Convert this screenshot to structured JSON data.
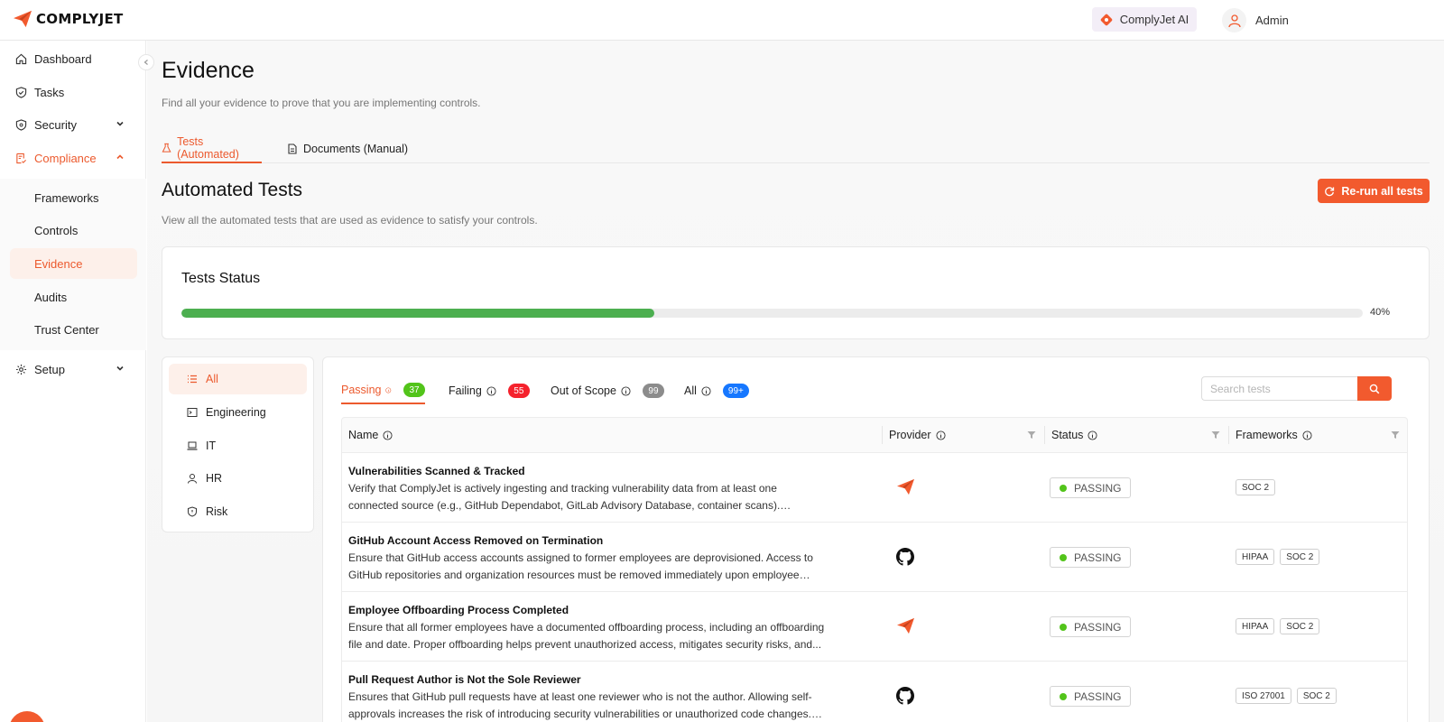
{
  "brand": {
    "name": "COMPLYJET",
    "accent": "#f25a2e"
  },
  "topbar": {
    "ai_label": "ComplyJet AI",
    "user_name": "Admin"
  },
  "sidebar": {
    "items": [
      {
        "label": "Dashboard",
        "icon": "home-icon"
      },
      {
        "label": "Tasks",
        "icon": "shield-check-icon"
      },
      {
        "label": "Security",
        "icon": "shield-icon"
      },
      {
        "label": "Compliance",
        "icon": "compliance-doc-icon"
      },
      {
        "label": "Setup",
        "icon": "gear-icon"
      }
    ],
    "compliance_sub": [
      {
        "label": "Frameworks"
      },
      {
        "label": "Controls"
      },
      {
        "label": "Evidence",
        "active": true
      },
      {
        "label": "Audits"
      },
      {
        "label": "Trust Center"
      }
    ]
  },
  "page": {
    "title": "Evidence",
    "description": "Find all your evidence to prove that you are implementing controls.",
    "tabs": [
      {
        "label": "Tests (Automated)",
        "active": true
      },
      {
        "label": "Documents (Manual)"
      }
    ]
  },
  "section": {
    "title": "Automated Tests",
    "description": "View all the automated tests that are used as evidence to satisfy your controls.",
    "rerun_label": "Re-run all tests"
  },
  "status": {
    "title": "Tests Status",
    "percent": 40,
    "percent_label": "40%"
  },
  "categories": [
    {
      "label": "All",
      "icon": "list-icon",
      "active": true
    },
    {
      "label": "Engineering",
      "icon": "terminal-icon"
    },
    {
      "label": "IT",
      "icon": "laptop-icon"
    },
    {
      "label": "HR",
      "icon": "user-icon"
    },
    {
      "label": "Risk",
      "icon": "shield-icon"
    }
  ],
  "filters": [
    {
      "label": "Passing",
      "count": "37",
      "color": "#52c41a",
      "active": true
    },
    {
      "label": "Failing",
      "count": "55",
      "color": "#f5222d"
    },
    {
      "label": "Out of Scope",
      "count": "99",
      "color": "#8c8c8c"
    },
    {
      "label": "All",
      "count": "99+",
      "color": "#1677ff"
    }
  ],
  "search": {
    "placeholder": "Search tests"
  },
  "table": {
    "columns": [
      "Name",
      "Provider",
      "Status",
      "Frameworks"
    ],
    "rows": [
      {
        "title": "Vulnerabilities Scanned & Tracked",
        "description": "Verify that ComplyJet is actively ingesting and tracking vulnerability data from at least one connected source (e.g., GitHub Dependabot, GitLab Advisory Database, container scans). Continuous vulnerability tracking...",
        "provider": "complyjet-icon",
        "status": "PASSING",
        "frameworks": [
          "SOC 2"
        ]
      },
      {
        "title": "GitHub Account Access Removed on Termination",
        "description": "Ensure that GitHub access accounts assigned to former employees are deprovisioned. Access to GitHub repositories and organization resources must be removed immediately upon employee termination...",
        "provider": "github-icon",
        "status": "PASSING",
        "frameworks": [
          "HIPAA",
          "SOC 2"
        ]
      },
      {
        "title": "Employee Offboarding Process Completed",
        "description": "Ensure that all former employees have a documented offboarding process, including an offboarding file and date. Proper offboarding helps prevent unauthorized access, mitigates security risks, and...",
        "provider": "complyjet-icon",
        "status": "PASSING",
        "frameworks": [
          "HIPAA",
          "SOC 2"
        ]
      },
      {
        "title": "Pull Request Author is Not the Sole Reviewer",
        "description": "Ensures that GitHub pull requests have at least one reviewer who is not the author. Allowing self-approvals increases the risk of introducing security vulnerabilities or unauthorized code changes. SO...",
        "provider": "github-icon",
        "status": "PASSING",
        "frameworks": [
          "ISO 27001",
          "SOC 2"
        ]
      }
    ]
  }
}
